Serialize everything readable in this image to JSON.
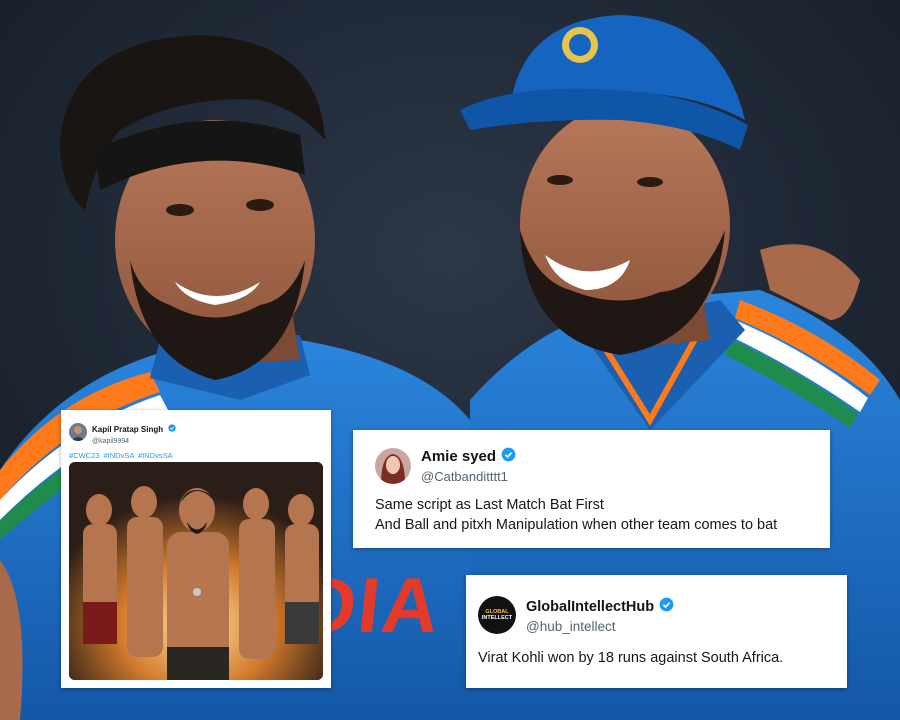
{
  "colors": {
    "accent": "#1d9bf0",
    "jersey_blue": "#1e73c8",
    "cap_blue": "#1565c0"
  },
  "background_photo": {
    "jersey_text": "DIA"
  },
  "tweets": [
    {
      "display_name": "Kapil Pratap Singh",
      "handle": "@kapil9994",
      "verified_icon": "verified-badge-icon",
      "hashtags": "#CWC23 #INDvSA #INDvsSA",
      "media": "wrestling-poster-image"
    },
    {
      "display_name": "Amie syed",
      "handle": "@Catbanditttt1",
      "verified_icon": "verified-badge-icon",
      "text_line1": "Same script as Last Match Bat First",
      "text_line2": "And Ball and pitxh Manipulation when other team comes to bat"
    },
    {
      "display_name": "GlobalIntellectHub",
      "handle": "@hub_intellect",
      "verified_icon": "verified-badge-icon",
      "avatar_text_1": "GLOBAL",
      "avatar_text_2": "INTELLECT",
      "text": "Virat Kohli won by 18 runs against South Africa."
    }
  ]
}
